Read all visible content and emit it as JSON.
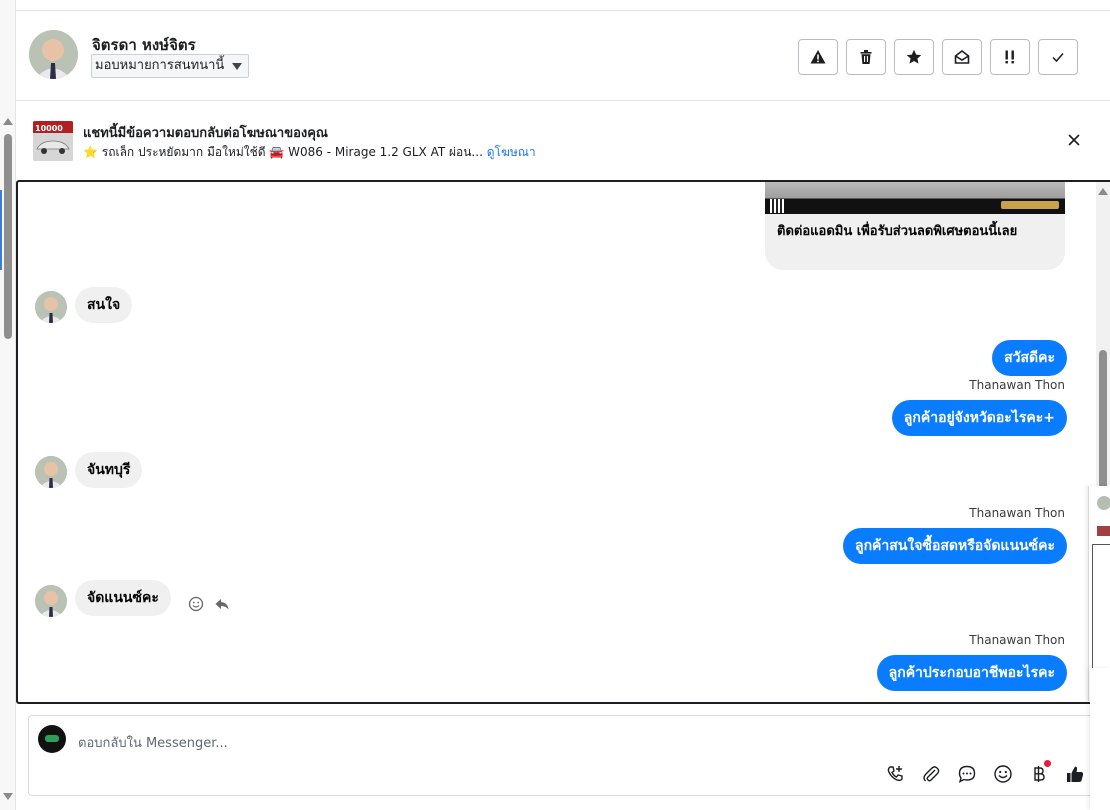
{
  "header": {
    "contact_name": "จิตรดา หงษ์จิตร",
    "assign_label": "มอบหมายการสนทนานี้",
    "actions": [
      "report-spam",
      "delete",
      "star",
      "mark-unread",
      "follow-up",
      "done"
    ]
  },
  "ad_banner": {
    "title": "แชทนี้มีข้อความตอบกลับต่อโฆษณาของคุณ",
    "subtitle": "⭐ รถเล็ก ประหยัดมาก มือใหม่ใช้ดี 🚘 W086 - Mirage 1.2 GLX AT ผ่อน...",
    "link": "ดูโฆษณา",
    "thumb_text": "10000"
  },
  "ad_card": {
    "caption": "ติดต่อแอดมิน เพื่อรับส่วนลดพิเศษตอนนี้เลย"
  },
  "messages": [
    {
      "dir": "in",
      "text": "สนใจ"
    },
    {
      "dir": "out",
      "text": "สวัสดีคะ"
    },
    {
      "dir": "out",
      "sender": "Thanawan Thon",
      "text": "ลูกค้าอยู่จังหวัดอะไรคะ+"
    },
    {
      "dir": "in",
      "text": "จันทบุรี"
    },
    {
      "dir": "out",
      "sender": "Thanawan Thon",
      "text": "ลูกค้าสนใจซื้อสดหรือจัดแนนซ์คะ"
    },
    {
      "dir": "in",
      "text": "จัดแนนซ์คะ"
    },
    {
      "dir": "out",
      "sender": "Thanawan Thon",
      "text": "ลูกค้าประกอบอาชีพอะไรคะ"
    }
  ],
  "composer": {
    "placeholder": "ตอบกลับใน Messenger...",
    "tools": [
      "call-plus-icon",
      "attach-icon",
      "saved-reply-icon",
      "emoji-icon",
      "baht-icon",
      "like-icon"
    ]
  },
  "colors": {
    "outgoing_bubble": "#0a7cff",
    "incoming_bubble": "#f0f0f0",
    "link": "#1877f2"
  }
}
